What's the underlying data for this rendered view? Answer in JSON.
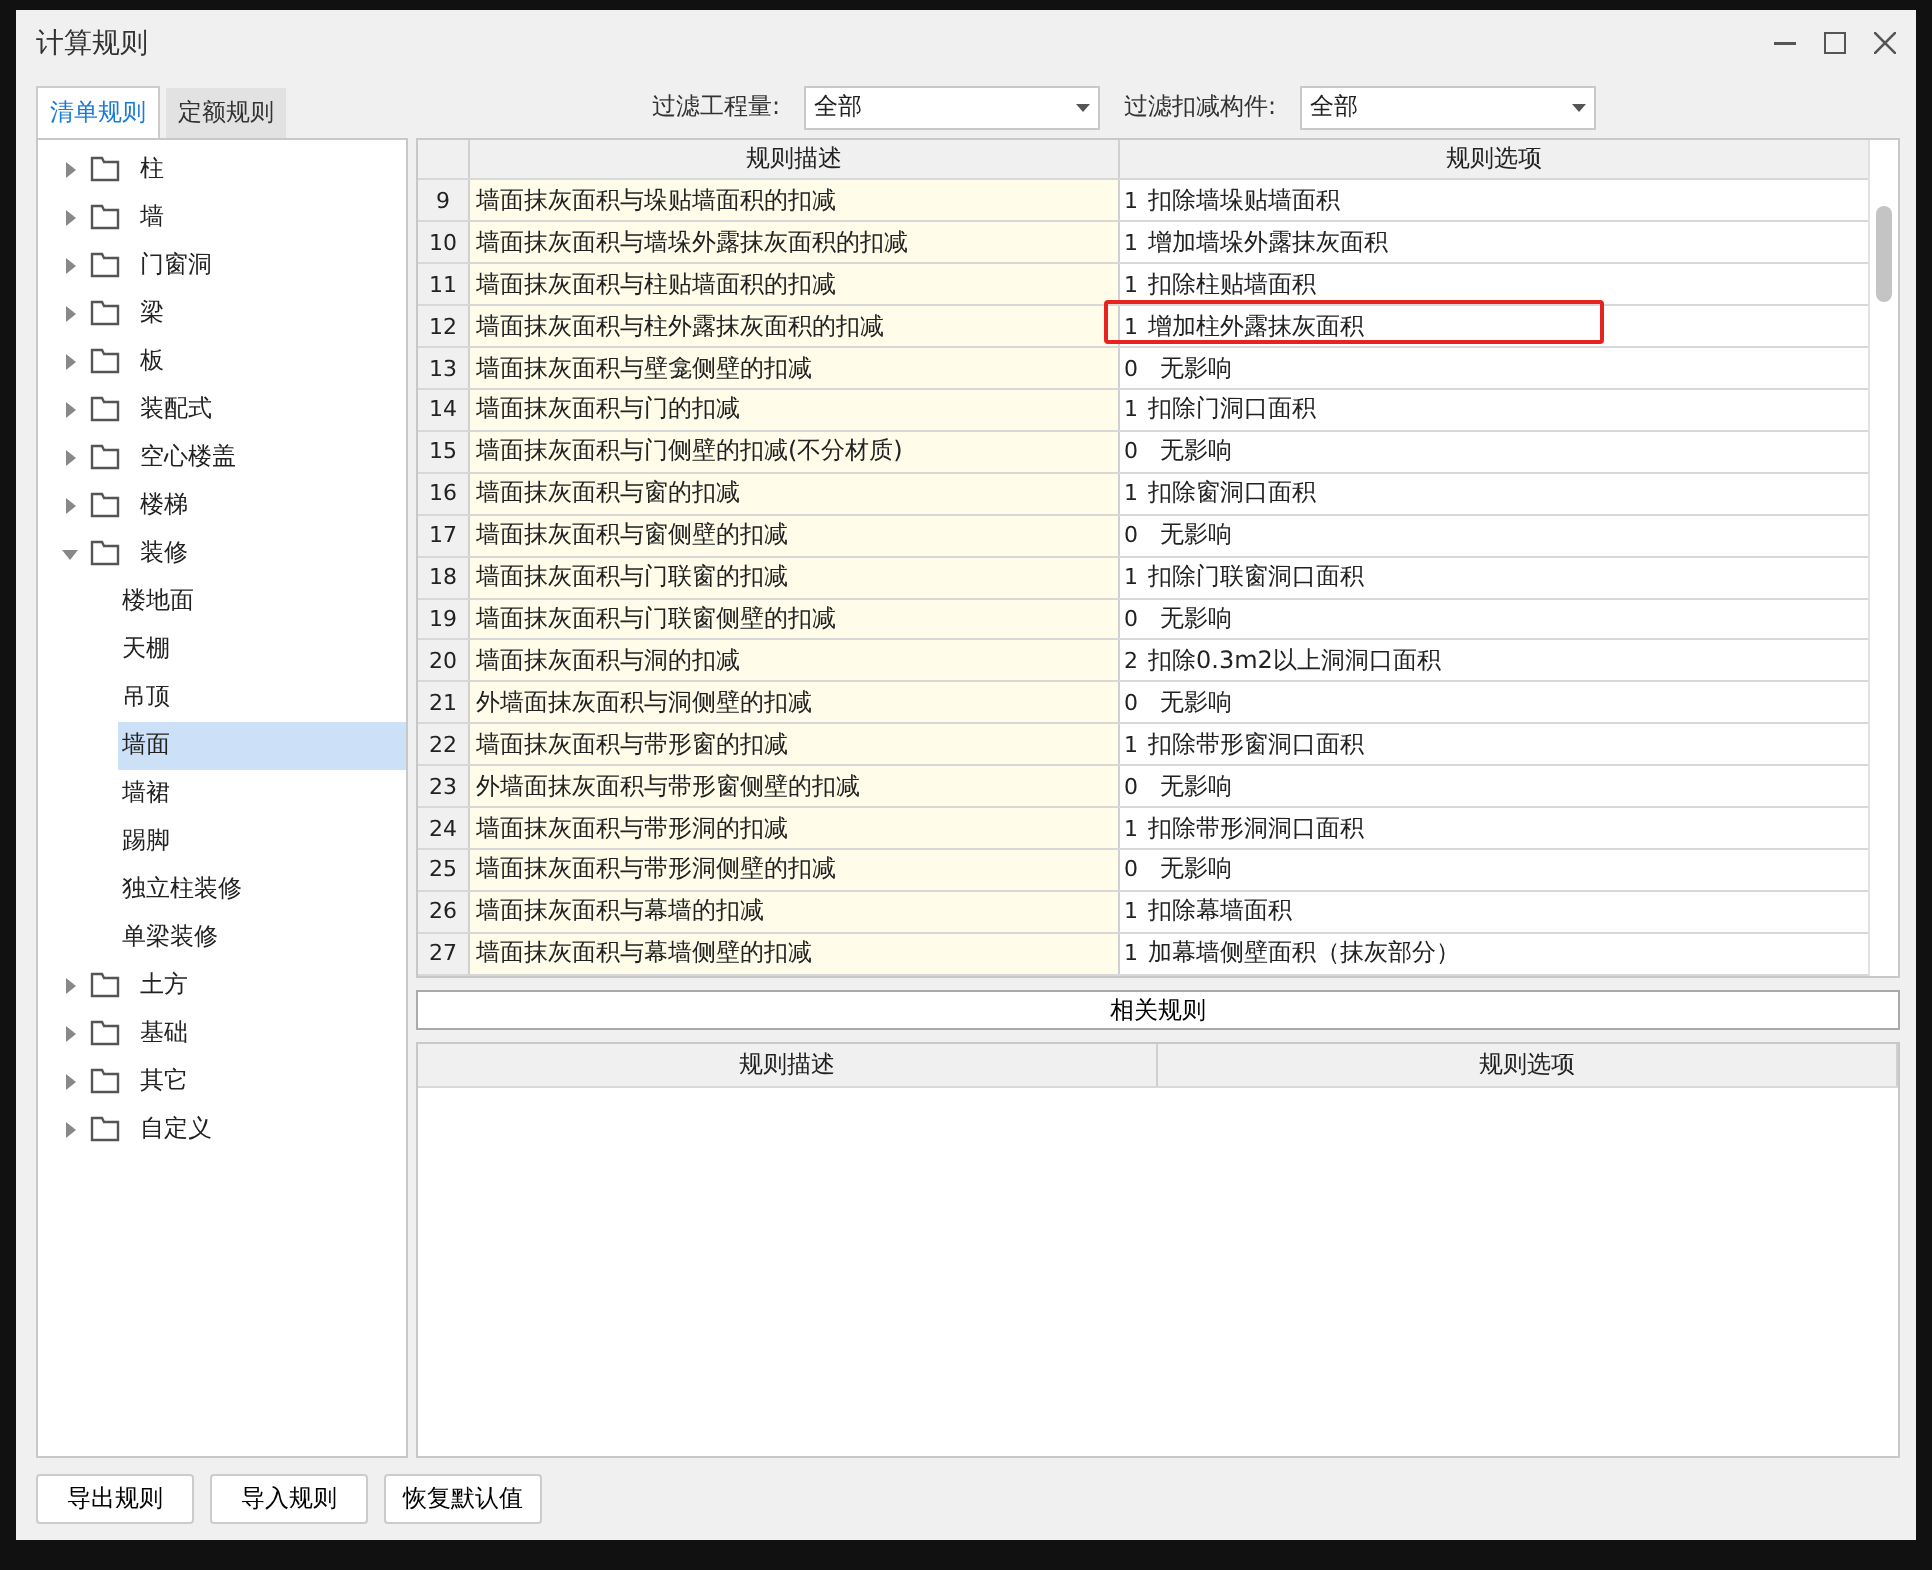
{
  "window": {
    "title": "计算规则"
  },
  "tabs": [
    {
      "label": "清单规则",
      "selected": true
    },
    {
      "label": "定额规则",
      "selected": false
    }
  ],
  "filters": [
    {
      "label": "过滤工程量:",
      "value": "全部"
    },
    {
      "label": "过滤扣减构件:",
      "value": "全部"
    }
  ],
  "tree": [
    {
      "label": "柱",
      "expanded": false,
      "selected": false
    },
    {
      "label": "墙",
      "expanded": false,
      "selected": false
    },
    {
      "label": "门窗洞",
      "expanded": false,
      "selected": false
    },
    {
      "label": "梁",
      "expanded": false,
      "selected": false
    },
    {
      "label": "板",
      "expanded": false,
      "selected": false
    },
    {
      "label": "装配式",
      "expanded": false,
      "selected": false
    },
    {
      "label": "空心楼盖",
      "expanded": false,
      "selected": false
    },
    {
      "label": "楼梯",
      "expanded": false,
      "selected": false
    },
    {
      "label": "装修",
      "expanded": true,
      "selected": false,
      "children": [
        {
          "label": "楼地面",
          "selected": false
        },
        {
          "label": "天棚",
          "selected": false
        },
        {
          "label": "吊顶",
          "selected": false
        },
        {
          "label": "墙面",
          "selected": true
        },
        {
          "label": "墙裙",
          "selected": false
        },
        {
          "label": "踢脚",
          "selected": false
        },
        {
          "label": "独立柱装修",
          "selected": false
        },
        {
          "label": "单梁装修",
          "selected": false
        }
      ]
    },
    {
      "label": "土方",
      "expanded": false,
      "selected": false
    },
    {
      "label": "基础",
      "expanded": false,
      "selected": false
    },
    {
      "label": "其它",
      "expanded": false,
      "selected": false
    },
    {
      "label": "自定义",
      "expanded": false,
      "selected": false
    }
  ],
  "table": {
    "columns": [
      "规则描述",
      "规则选项"
    ],
    "rows": [
      {
        "num": "9",
        "description": "墙面抹灰面积与垛贴墙面积的扣减",
        "code": "1",
        "option": "扣除墙垛贴墙面积",
        "highlighted": false
      },
      {
        "num": "10",
        "description": "墙面抹灰面积与墙垛外露抹灰面积的扣减",
        "code": "1",
        "option": "增加墙垛外露抹灰面积",
        "highlighted": false
      },
      {
        "num": "11",
        "description": "墙面抹灰面积与柱贴墙面积的扣减",
        "code": "1",
        "option": "扣除柱贴墙面积",
        "highlighted": false
      },
      {
        "num": "12",
        "description": "墙面抹灰面积与柱外露抹灰面积的扣减",
        "code": "1",
        "option": "增加柱外露抹灰面积",
        "highlighted": true
      },
      {
        "num": "13",
        "description": "墙面抹灰面积与壁龛侧壁的扣减",
        "code": "0",
        "option": "无影响",
        "highlighted": false
      },
      {
        "num": "14",
        "description": "墙面抹灰面积与门的扣减",
        "code": "1",
        "option": "扣除门洞口面积",
        "highlighted": false
      },
      {
        "num": "15",
        "description": "墙面抹灰面积与门侧壁的扣减(不分材质)",
        "code": "0",
        "option": "无影响",
        "highlighted": false
      },
      {
        "num": "16",
        "description": "墙面抹灰面积与窗的扣减",
        "code": "1",
        "option": "扣除窗洞口面积",
        "highlighted": false
      },
      {
        "num": "17",
        "description": "墙面抹灰面积与窗侧壁的扣减",
        "code": "0",
        "option": "无影响",
        "highlighted": false
      },
      {
        "num": "18",
        "description": "墙面抹灰面积与门联窗的扣减",
        "code": "1",
        "option": "扣除门联窗洞口面积",
        "highlighted": false
      },
      {
        "num": "19",
        "description": "墙面抹灰面积与门联窗侧壁的扣减",
        "code": "0",
        "option": "无影响",
        "highlighted": false
      },
      {
        "num": "20",
        "description": "墙面抹灰面积与洞的扣减",
        "code": "2",
        "option": "扣除0.3m2以上洞洞口面积",
        "highlighted": false
      },
      {
        "num": "21",
        "description": "外墙面抹灰面积与洞侧壁的扣减",
        "code": "0",
        "option": "无影响",
        "highlighted": false
      },
      {
        "num": "22",
        "description": "墙面抹灰面积与带形窗的扣减",
        "code": "1",
        "option": "扣除带形窗洞口面积",
        "highlighted": false
      },
      {
        "num": "23",
        "description": "外墙面抹灰面积与带形窗侧壁的扣减",
        "code": "0",
        "option": "无影响",
        "highlighted": false
      },
      {
        "num": "24",
        "description": "墙面抹灰面积与带形洞的扣减",
        "code": "1",
        "option": "扣除带形洞洞口面积",
        "highlighted": false
      },
      {
        "num": "25",
        "description": "墙面抹灰面积与带形洞侧壁的扣减",
        "code": "0",
        "option": "无影响",
        "highlighted": false
      },
      {
        "num": "26",
        "description": "墙面抹灰面积与幕墙的扣减",
        "code": "1",
        "option": "扣除幕墙面积",
        "highlighted": false
      },
      {
        "num": "27",
        "description": "墙面抹灰面积与幕墙侧壁的扣减",
        "code": "1",
        "option": "加幕墙侧壁面积（抹灰部分）",
        "highlighted": false
      }
    ]
  },
  "related_button": "相关规则",
  "related_table": {
    "columns": [
      "规则描述",
      "规则选项"
    ]
  },
  "buttons": [
    "导出规则",
    "导入规则",
    "恢复默认值"
  ]
}
